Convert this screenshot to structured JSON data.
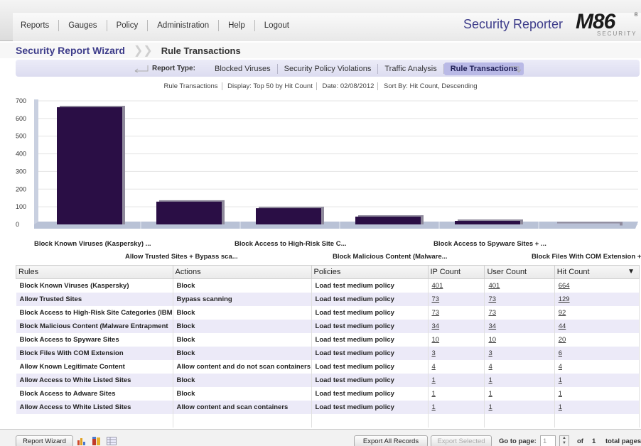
{
  "nav": {
    "items": [
      "Reports",
      "Gauges",
      "Policy",
      "Administration",
      "Help",
      "Logout"
    ],
    "app_title": "Security Reporter",
    "logo_main": "M86",
    "logo_sub": "SECURITY",
    "logo_reg": "®"
  },
  "breadcrumb": {
    "wizard": "Security Report Wizard",
    "current": "Rule Transactions"
  },
  "report_type": {
    "label": "Report Type:",
    "tabs": [
      "Blocked Viruses",
      "Security Policy Violations",
      "Traffic Analysis",
      "Rule Transactions"
    ],
    "active": "Rule Transactions"
  },
  "info": {
    "report": "Rule Transactions",
    "display": "Display: Top 50 by Hit Count",
    "date": "Date: 02/08/2012",
    "sort": "Sort By: Hit Count, Descending"
  },
  "chart_data": {
    "type": "bar",
    "categories": [
      "Block Known Viruses (Kaspersky) ...",
      "Allow Trusted Sites + Bypass sca...",
      "Block Access to High-Risk Site C...",
      "Block Malicious Content (Malware...",
      "Block Access to Spyware Sites + ...",
      "Block Files With COM Extension +..."
    ],
    "values": [
      664,
      129,
      92,
      44,
      20,
      6
    ],
    "yticks": [
      "700",
      "600",
      "500",
      "400",
      "300",
      "200",
      "100",
      "0"
    ],
    "ylim": [
      0,
      700
    ],
    "grid": true,
    "bar_color": "#2a0e45",
    "last_bar_color": "#b9c0d6"
  },
  "table": {
    "columns": [
      "Rules",
      "Actions",
      "Policies",
      "IP Count",
      "User Count",
      "Hit Count"
    ],
    "sort_indicator": "▼",
    "rows": [
      [
        "Block Known Viruses (Kaspersky)",
        "Block",
        "Load test medium policy",
        "401",
        "401",
        "664"
      ],
      [
        "Allow Trusted Sites",
        "Bypass scanning",
        "Load test medium policy",
        "73",
        "73",
        "129"
      ],
      [
        "Block Access to High-Risk Site Categories (IBM",
        "Block",
        "Load test medium policy",
        "73",
        "73",
        "92"
      ],
      [
        "Block Malicious Content (Malware Entrapment",
        "Block",
        "Load test medium policy",
        "34",
        "34",
        "44"
      ],
      [
        "Block Access to Spyware Sites",
        "Block",
        "Load test medium policy",
        "10",
        "10",
        "20"
      ],
      [
        "Block Files With COM Extension",
        "Block",
        "Load test medium policy",
        "3",
        "3",
        "6"
      ],
      [
        "Allow Known Legitimate Content",
        "Allow content and do not scan containers",
        "Load test medium policy",
        "4",
        "4",
        "4"
      ],
      [
        "Allow Access to White Listed Sites",
        "Block",
        "Load test medium policy",
        "1",
        "1",
        "1"
      ],
      [
        "Block Access to Adware Sites",
        "Block",
        "Load test medium policy",
        "1",
        "1",
        "1"
      ],
      [
        "Allow Access to White Listed Sites",
        "Allow content and scan containers",
        "Load test medium policy",
        "1",
        "1",
        "1"
      ]
    ]
  },
  "footer": {
    "report_wizard": "Report Wizard",
    "export_all": "Export All Records",
    "export_selected": "Export Selected",
    "goto_label": "Go to page:",
    "page_value": "1",
    "of_label": "of",
    "total": "1",
    "total_label": "total pages"
  }
}
